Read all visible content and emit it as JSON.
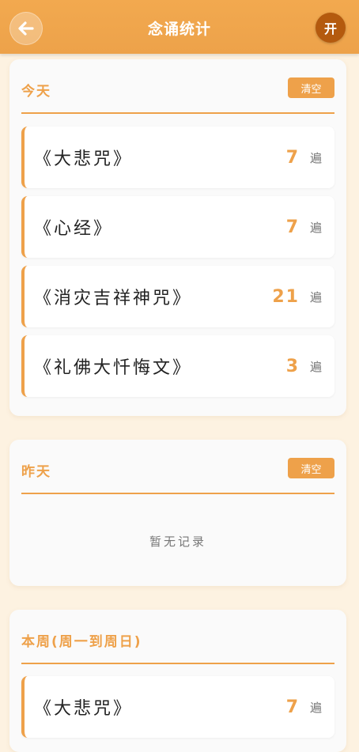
{
  "header": {
    "title": "念诵统计",
    "open_label": "开"
  },
  "today": {
    "title": "今天",
    "clear_label": "清空",
    "items": [
      {
        "name": "《大悲咒》",
        "count": "7",
        "unit": "遍"
      },
      {
        "name": "《心经》",
        "count": "7",
        "unit": "遍"
      },
      {
        "name": "《消灾吉祥神咒》",
        "count": "21",
        "unit": "遍"
      },
      {
        "name": "《礼佛大忏悔文》",
        "count": "3",
        "unit": "遍"
      }
    ]
  },
  "yesterday": {
    "title": "昨天",
    "clear_label": "清空",
    "empty_text": "暂无记录"
  },
  "week": {
    "title": "本周(周一到周日)",
    "items": [
      {
        "name": "《大悲咒》",
        "count": "7",
        "unit": "遍"
      }
    ]
  },
  "colors": {
    "accent": "#eea14a",
    "header": "#f2a94f",
    "open_button": "#b45a0e",
    "background": "#fdf2e1"
  }
}
